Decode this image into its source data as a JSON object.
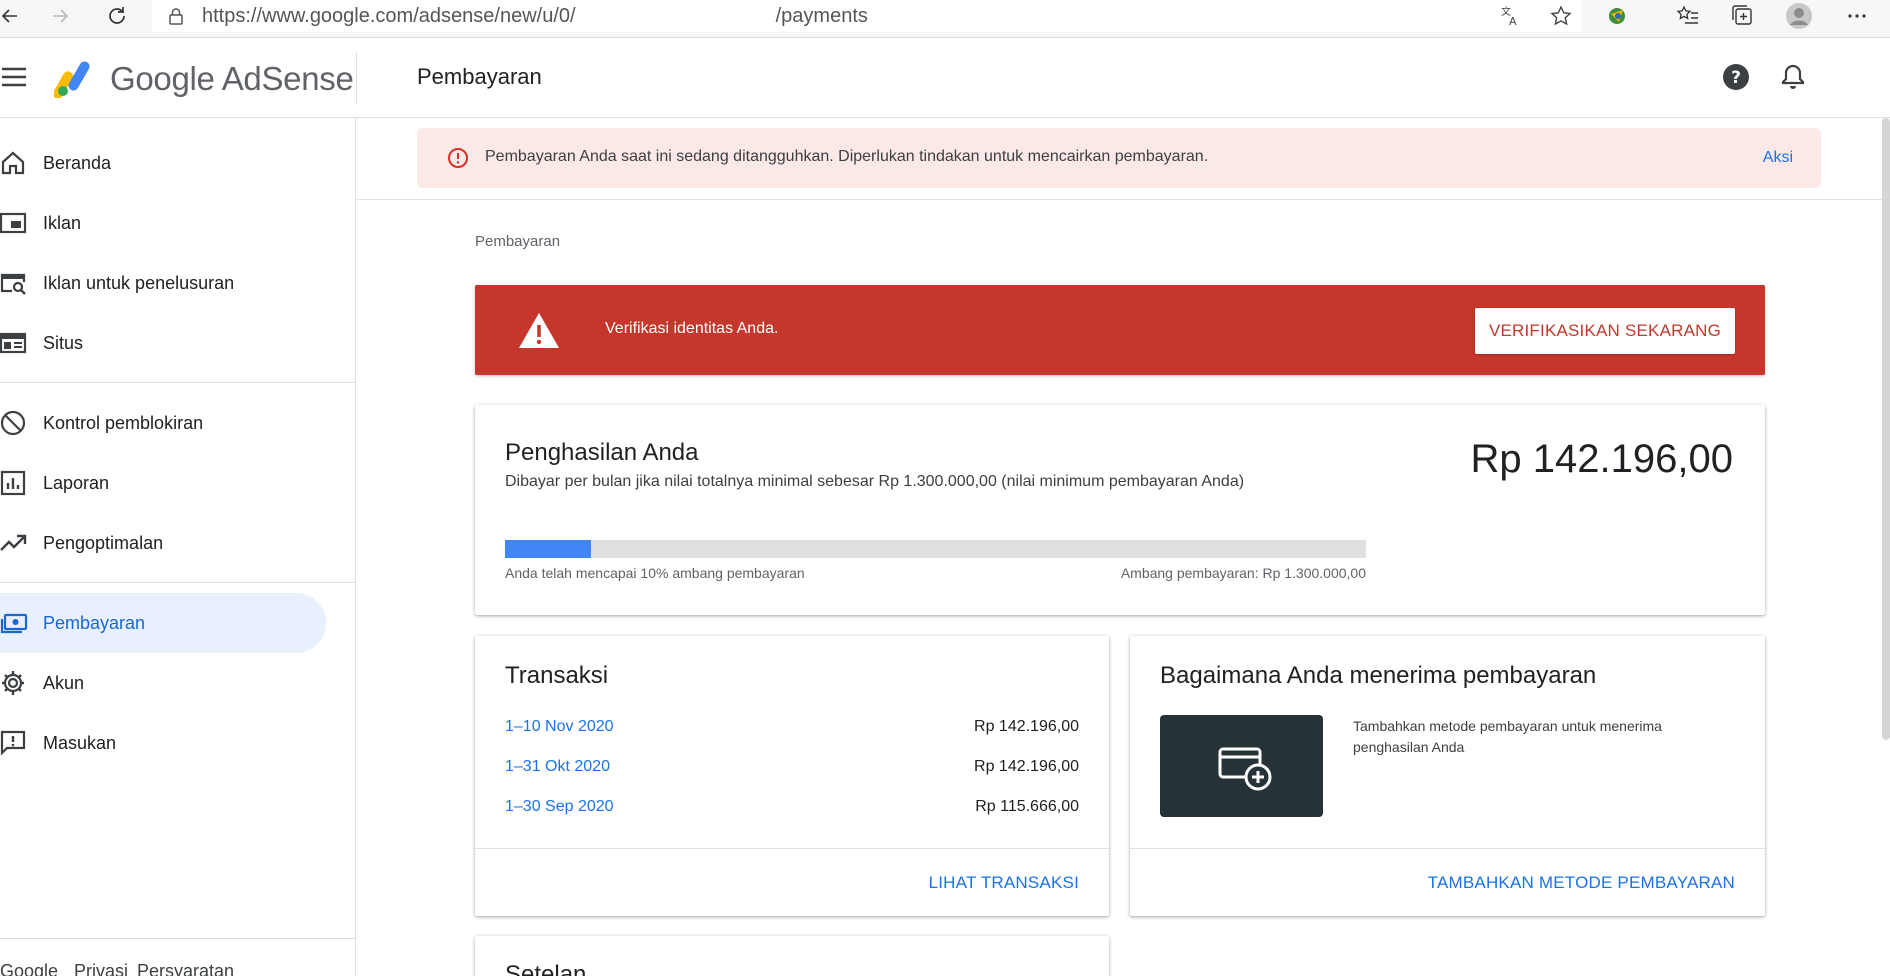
{
  "browser": {
    "url_prefix": "https://www.google.com/",
    "url_mid": "adsense/new/u/0/",
    "url_suffix": "/payments",
    "icons": [
      "back-icon",
      "forward-icon",
      "reload-icon",
      "lock-icon",
      "translate-icon",
      "star-icon",
      "extension-icon",
      "favorites-icon",
      "collections-icon",
      "profile-icon",
      "more-icon"
    ]
  },
  "header": {
    "brand_google": "Google",
    "brand_adsense": "AdSense",
    "page_title": "Pembayaran",
    "icons": [
      "menu-icon",
      "adsense-logo",
      "help-icon",
      "notifications-icon"
    ]
  },
  "sidebar": {
    "items": [
      {
        "label": "Beranda",
        "icon": "home-icon"
      },
      {
        "label": "Iklan",
        "icon": "ads-icon"
      },
      {
        "label": "Iklan untuk penelusuran",
        "icon": "search-ads-icon"
      },
      {
        "label": "Situs",
        "icon": "sites-icon"
      },
      {
        "label": "Kontrol pemblokiran",
        "icon": "block-icon"
      },
      {
        "label": "Laporan",
        "icon": "reports-icon"
      },
      {
        "label": "Pengoptimalan",
        "icon": "optimization-icon"
      },
      {
        "label": "Pembayaran",
        "icon": "payments-icon",
        "active": true
      },
      {
        "label": "Akun",
        "icon": "gear-icon"
      },
      {
        "label": "Masukan",
        "icon": "feedback-icon"
      }
    ],
    "footer": {
      "brand": "Google",
      "privacy": "Privasi",
      "terms": "Persyaratan"
    }
  },
  "alert": {
    "text": "Pembayaran Anda saat ini sedang ditangguhkan. Diperlukan tindakan untuk mencairkan pembayaran.",
    "action": "Aksi"
  },
  "main": {
    "breadcrumb": "Pembayaran",
    "verify": {
      "text": "Verifikasi identitas Anda.",
      "button": "VERIFIKASIKAN SEKARANG",
      "color": "#c5372c"
    },
    "earnings": {
      "title": "Penghasilan Anda",
      "subtitle": "Dibayar per bulan jika nilai totalnya minimal sebesar Rp 1.300.000,00 (nilai minimum pembayaran Anda)",
      "amount": "Rp 142.196,00",
      "progress": 0.1,
      "progress_label": "Anda telah mencapai 10% ambang pembayaran",
      "threshold_label": "Ambang pembayaran: Rp 1.300.000,00",
      "bar_color": "#4285f4"
    },
    "transactions": {
      "title": "Transaksi",
      "rows": [
        {
          "period": "1–10 Nov 2020",
          "amount": "Rp 142.196,00"
        },
        {
          "period": "1–31 Okt 2020",
          "amount": "Rp 142.196,00"
        },
        {
          "period": "1–30 Sep 2020",
          "amount": "Rp 115.666,00"
        }
      ],
      "link": "LIHAT TRANSAKSI"
    },
    "payment_method": {
      "title": "Bagaimana Anda menerima pembayaran",
      "text": "Tambahkan metode pembayaran untuk menerima penghasilan Anda",
      "link": "TAMBAHKAN METODE PEMBAYARAN",
      "icon": "add-card-icon"
    },
    "settings": {
      "title": "Setelan"
    }
  }
}
